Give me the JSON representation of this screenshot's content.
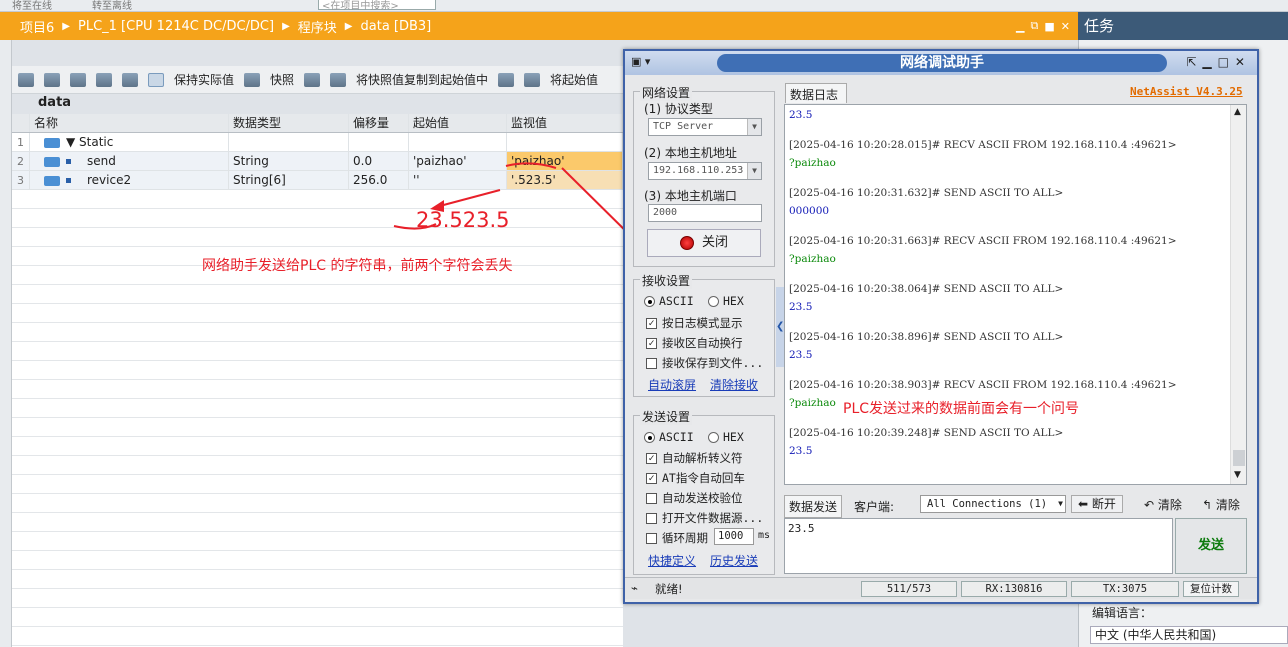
{
  "top": {
    "t1": "将至在线",
    "t2": "转至离线",
    "search_placeholder": "<在项目中搜索>"
  },
  "breadcrumb": [
    "项目6",
    "PLC_1 [CPU 1214C DC/DC/DC]",
    "程序块",
    "data [DB3]"
  ],
  "task_title": "任务",
  "toolbar": {
    "keep_actual": "保持实际值",
    "snapshot": "快照",
    "copy_snapshot": "将快照值复制到起始值中",
    "load_start": "将起始值"
  },
  "db_name": "data",
  "table": {
    "headers": [
      "名称",
      "数据类型",
      "偏移量",
      "起始值",
      "监视值"
    ],
    "rows": [
      {
        "num": "1",
        "name": "Static",
        "type": "",
        "offset": "",
        "start": "",
        "monitor": ""
      },
      {
        "num": "2",
        "name": "send",
        "type": "String",
        "offset": "0.0",
        "start": "'paizhao'",
        "monitor": "'paizhao'"
      },
      {
        "num": "3",
        "name": "revice2",
        "type": "String[6]",
        "offset": "256.0",
        "start": "''",
        "monitor": "'.523.5'"
      }
    ]
  },
  "annotations": {
    "big": "23.523.5",
    "note1": "网络助手发送给PLC 的字符串，前两个字符会丢失",
    "note2": "PLC发送过来的数据前面会有一个问号"
  },
  "netassist": {
    "title": "网络调试助手",
    "version": "NetAssist V4.3.25",
    "net_settings": "网络设置",
    "protocol_label": "(1) 协议类型",
    "protocol_value": "TCP Server",
    "host_label": "(2) 本地主机地址",
    "host_value": "192.168.110.253",
    "port_label": "(3) 本地主机端口",
    "port_value": "2000",
    "close_btn": "关闭",
    "recv_settings": "接收设置",
    "recv_ascii": "ASCII",
    "recv_hex": "HEX",
    "recv_opts": [
      "按日志模式显示",
      "接收区自动换行",
      "接收保存到文件..."
    ],
    "auto_scroll": "自动滚屏",
    "clear_recv": "清除接收",
    "send_settings": "发送设置",
    "send_ascii": "ASCII",
    "send_hex": "HEX",
    "send_opts": [
      "自动解析转义符",
      "AT指令自动回车",
      "自动发送校验位",
      "打开文件数据源...",
      "循环周期"
    ],
    "cycle_value": "1000",
    "cycle_unit": "ms",
    "shortcut": "快捷定义",
    "history": "历史发送",
    "log_tab": "数据日志",
    "log": [
      {
        "t": "23.5",
        "c": "send"
      },
      {
        "t": "[2025-04-16 10:20:28.015]# RECV ASCII FROM 192.168.110.4 :49621>",
        "c": "hdrtxt"
      },
      {
        "t": "?paizhao",
        "c": "recv"
      },
      {
        "t": "[2025-04-16 10:20:31.632]# SEND ASCII TO ALL>",
        "c": "hdrtxt"
      },
      {
        "t": "000000",
        "c": "send"
      },
      {
        "t": "[2025-04-16 10:20:31.663]# RECV ASCII FROM 192.168.110.4 :49621>",
        "c": "hdrtxt"
      },
      {
        "t": "?paizhao",
        "c": "recv"
      },
      {
        "t": "[2025-04-16 10:20:38.064]# SEND ASCII TO ALL>",
        "c": "hdrtxt"
      },
      {
        "t": "23.5",
        "c": "send"
      },
      {
        "t": "[2025-04-16 10:20:38.896]# SEND ASCII TO ALL>",
        "c": "hdrtxt"
      },
      {
        "t": "23.5",
        "c": "send"
      },
      {
        "t": "[2025-04-16 10:20:38.903]# RECV ASCII FROM 192.168.110.4 :49621>",
        "c": "hdrtxt"
      },
      {
        "t": "?paizhao",
        "c": "recv"
      },
      {
        "t": "[2025-04-16 10:20:39.248]# SEND ASCII TO ALL>",
        "c": "hdrtxt"
      },
      {
        "t": "23.5",
        "c": "send"
      }
    ],
    "send_tab": "数据发送",
    "client_label": "客户端:",
    "conn_value": "All Connections (1)",
    "disconnect": "断开",
    "clear1": "清除",
    "clear2": "清除",
    "send_text": "23.5",
    "send_btn": "发送",
    "status_ready": "就绪!",
    "status_count": "511/573",
    "status_rx": "RX:130816",
    "status_tx": "TX:3075",
    "reset_count": "复位计数"
  },
  "right_panel": {
    "lang_label": "编辑语言：",
    "lang_value": "中文 (中华人民共和国)"
  }
}
